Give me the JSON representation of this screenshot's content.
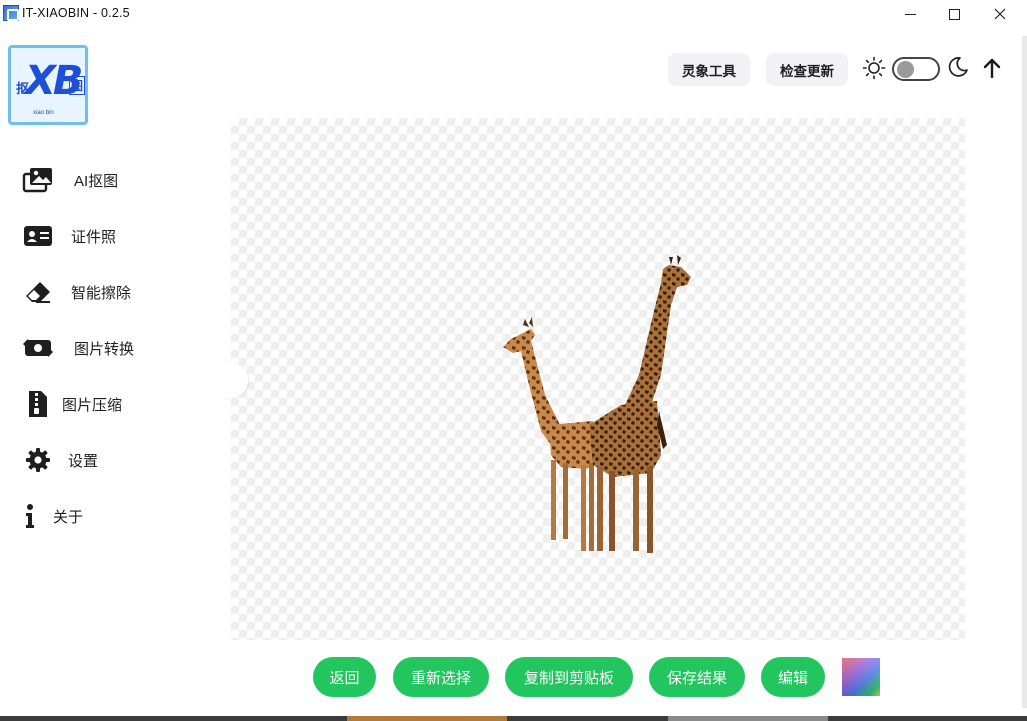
{
  "window": {
    "title": "IT-XIAOBIN - 0.2.5"
  },
  "logo": {
    "main": "XB",
    "left_char": "抠",
    "right_char": "图",
    "sub": "xiao bin"
  },
  "sidebar": {
    "items": [
      {
        "label": "AI抠图",
        "icon": "images-icon"
      },
      {
        "label": "证件照",
        "icon": "id-card-icon"
      },
      {
        "label": "智能擦除",
        "icon": "eraser-icon"
      },
      {
        "label": "图片转换",
        "icon": "convert-icon"
      },
      {
        "label": "图片压缩",
        "icon": "file-zip-icon"
      },
      {
        "label": "设置",
        "icon": "gear-icon"
      },
      {
        "label": "关于",
        "icon": "info-icon"
      }
    ]
  },
  "header": {
    "tool_button": "灵象工具",
    "update_button": "检查更新",
    "theme": "light"
  },
  "actions": {
    "back": "返回",
    "reselect": "重新选择",
    "copy": "复制到剪贴板",
    "save": "保存结果",
    "edit": "编辑"
  },
  "colors": {
    "accent": "#22c55e",
    "logo_border": "#6cc0ea",
    "logo_text": "#1e4fd6"
  }
}
